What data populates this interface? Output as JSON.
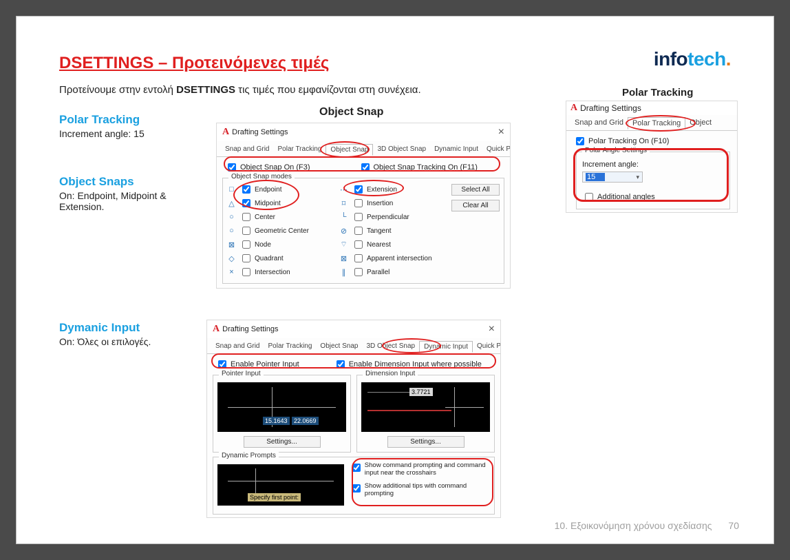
{
  "page": {
    "title": "DSETTINGS – Προτεινόμενες τιμές",
    "intro_a": "Προτείνουμε στην εντολή ",
    "intro_b": "DSETTINGS",
    "intro_c": " τις τιμές που εμφανίζονται στη συνέχεια.",
    "footer": "10. Εξοικονόμηση χρόνου σχεδίασης",
    "pagenum": "70"
  },
  "logo": {
    "part1": "info",
    "part2": "tech",
    "dot": "."
  },
  "sections": {
    "polar": {
      "title": "Polar Tracking",
      "body": "Increment angle: 15"
    },
    "osnaps": {
      "title": "Object Snaps",
      "body": "On: Endpoint, Midpoint & Extension."
    },
    "dyn": {
      "title": "Dymanic Input",
      "body": "On: Όλες οι επιλογές."
    }
  },
  "osnap_dialog": {
    "heading": "Object Snap",
    "window_title": "Drafting Settings",
    "tabs": [
      "Snap and Grid",
      "Polar Tracking",
      "Object Snap",
      "3D Object Snap",
      "Dynamic Input",
      "Quick Properti"
    ],
    "chk_on": "Object Snap On (F3)",
    "chk_track": "Object Snap Tracking On (F11)",
    "modes_label": "Object Snap modes",
    "select_all": "Select All",
    "clear_all": "Clear All",
    "left": [
      "Endpoint",
      "Midpoint",
      "Center",
      "Geometric Center",
      "Node",
      "Quadrant",
      "Intersection"
    ],
    "right": [
      "Extension",
      "Insertion",
      "Perpendicular",
      "Tangent",
      "Nearest",
      "Apparent intersection",
      "Parallel"
    ]
  },
  "polar_dialog": {
    "heading": "Polar Tracking",
    "window_title": "Drafting Settings",
    "tabs": [
      "Snap and Grid",
      "Polar Tracking",
      "Object"
    ],
    "chk_on": "Polar Tracking On (F10)",
    "group": "Polar Angle Settings",
    "increment_label": "Increment angle:",
    "increment_value": "15",
    "additional_angles": "Additional angles"
  },
  "dyn_dialog": {
    "window_title": "Drafting Settings",
    "tabs": [
      "Snap and Grid",
      "Polar Tracking",
      "Object Snap",
      "3D Object Snap",
      "Dynamic Input",
      "Quick Properti"
    ],
    "chk_pointer": "Enable Pointer Input",
    "chk_dim": "Enable Dimension Input where possible",
    "grp_pointer": "Pointer Input",
    "grp_dim": "Dimension Input",
    "grp_prompts": "Dynamic Prompts",
    "settings_btn": "Settings...",
    "coord1": "15.1643",
    "coord2": "22.0669",
    "dim_val": "3.7721",
    "prompt_text": "Specify first point:",
    "chk_prompt1": "Show command prompting and command input near the crosshairs",
    "chk_prompt2": "Show additional tips with command prompting"
  }
}
